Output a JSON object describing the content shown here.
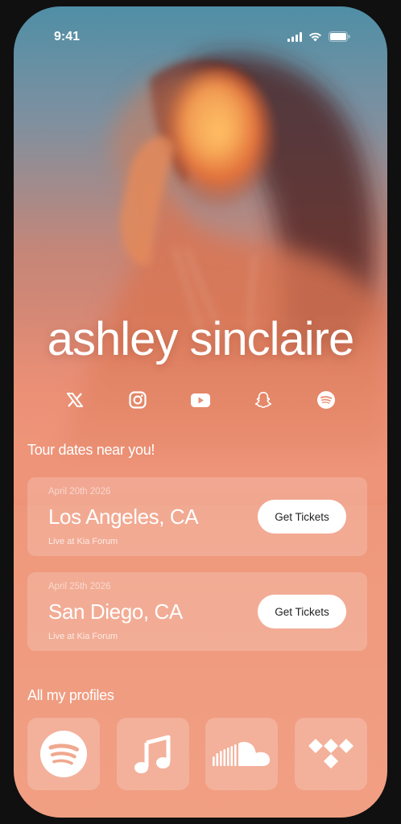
{
  "status_bar": {
    "time": "9:41"
  },
  "artist": {
    "name": "ashley sinclaire"
  },
  "social_icons": [
    "x-icon",
    "instagram-icon",
    "youtube-icon",
    "snapchat-icon",
    "spotify-icon"
  ],
  "tour": {
    "heading": "Tour dates near you!",
    "events": [
      {
        "date": "April 20th 2026",
        "city": "Los Angeles, CA",
        "venue": "Live at Kia Forum",
        "button": "Get Tickets"
      },
      {
        "date": "April 25th 2026",
        "city": "San Diego, CA",
        "venue": "Live at Kia Forum",
        "button": "Get Tickets"
      }
    ]
  },
  "profiles": {
    "heading": "All my profiles",
    "items": [
      "spotify-icon",
      "apple-music-icon",
      "soundcloud-icon",
      "tidal-icon"
    ]
  }
}
